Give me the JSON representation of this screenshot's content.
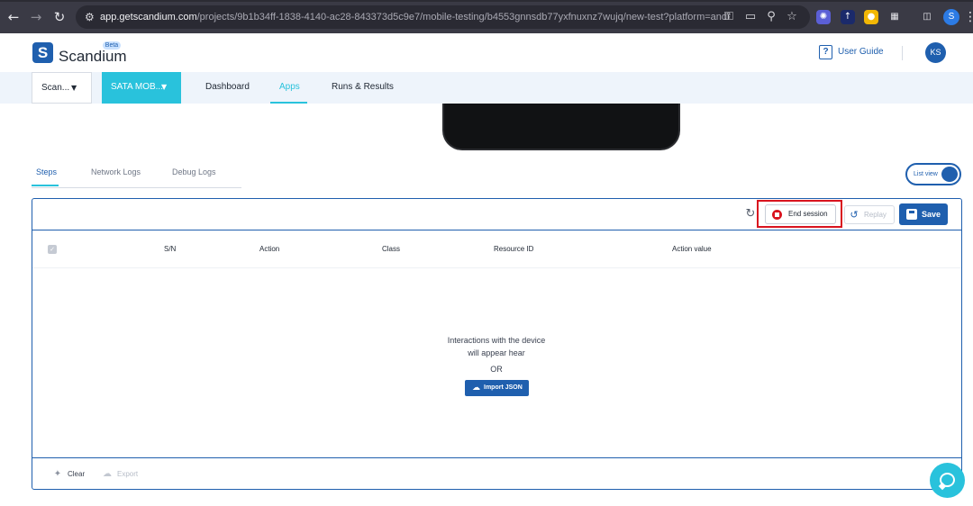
{
  "browser": {
    "url_host": "app.getscandium.com",
    "url_path": "/projects/9b1b34ff-1838-4140-ac28-843373d5c9e7/mobile-testing/b4553gnnsdb77yxfnuxnz7wujq/new-test?platform=android",
    "profile_initial": "S"
  },
  "header": {
    "logo_text": "Scandium",
    "beta_label": "Beta",
    "user_guide_label": "User Guide",
    "avatar_initials": "KS"
  },
  "navbar": {
    "workspace_select": "Scan...",
    "project_select": "SATA MOB...",
    "links": [
      "Dashboard",
      "Apps",
      "Runs & Results"
    ],
    "active_link": "Apps"
  },
  "tabs": {
    "items": [
      "Steps",
      "Network Logs",
      "Debug Logs"
    ],
    "active": "Steps"
  },
  "view_toggle": {
    "label": "List view",
    "on": true
  },
  "toolbar": {
    "end_session_label": "End session",
    "replay_label": "Replay",
    "save_label": "Save"
  },
  "table": {
    "columns": [
      "S/N",
      "Action",
      "Class",
      "Resource ID",
      "Action value"
    ]
  },
  "empty_state": {
    "line1": "Interactions with the device",
    "line2": "will appear hear",
    "or_label": "OR",
    "import_label": "Import JSON"
  },
  "footer": {
    "clear_label": "Clear",
    "export_label": "Export"
  },
  "colors": {
    "primary": "#1f5fae",
    "accent": "#29c2dc",
    "danger": "#d9141f"
  }
}
